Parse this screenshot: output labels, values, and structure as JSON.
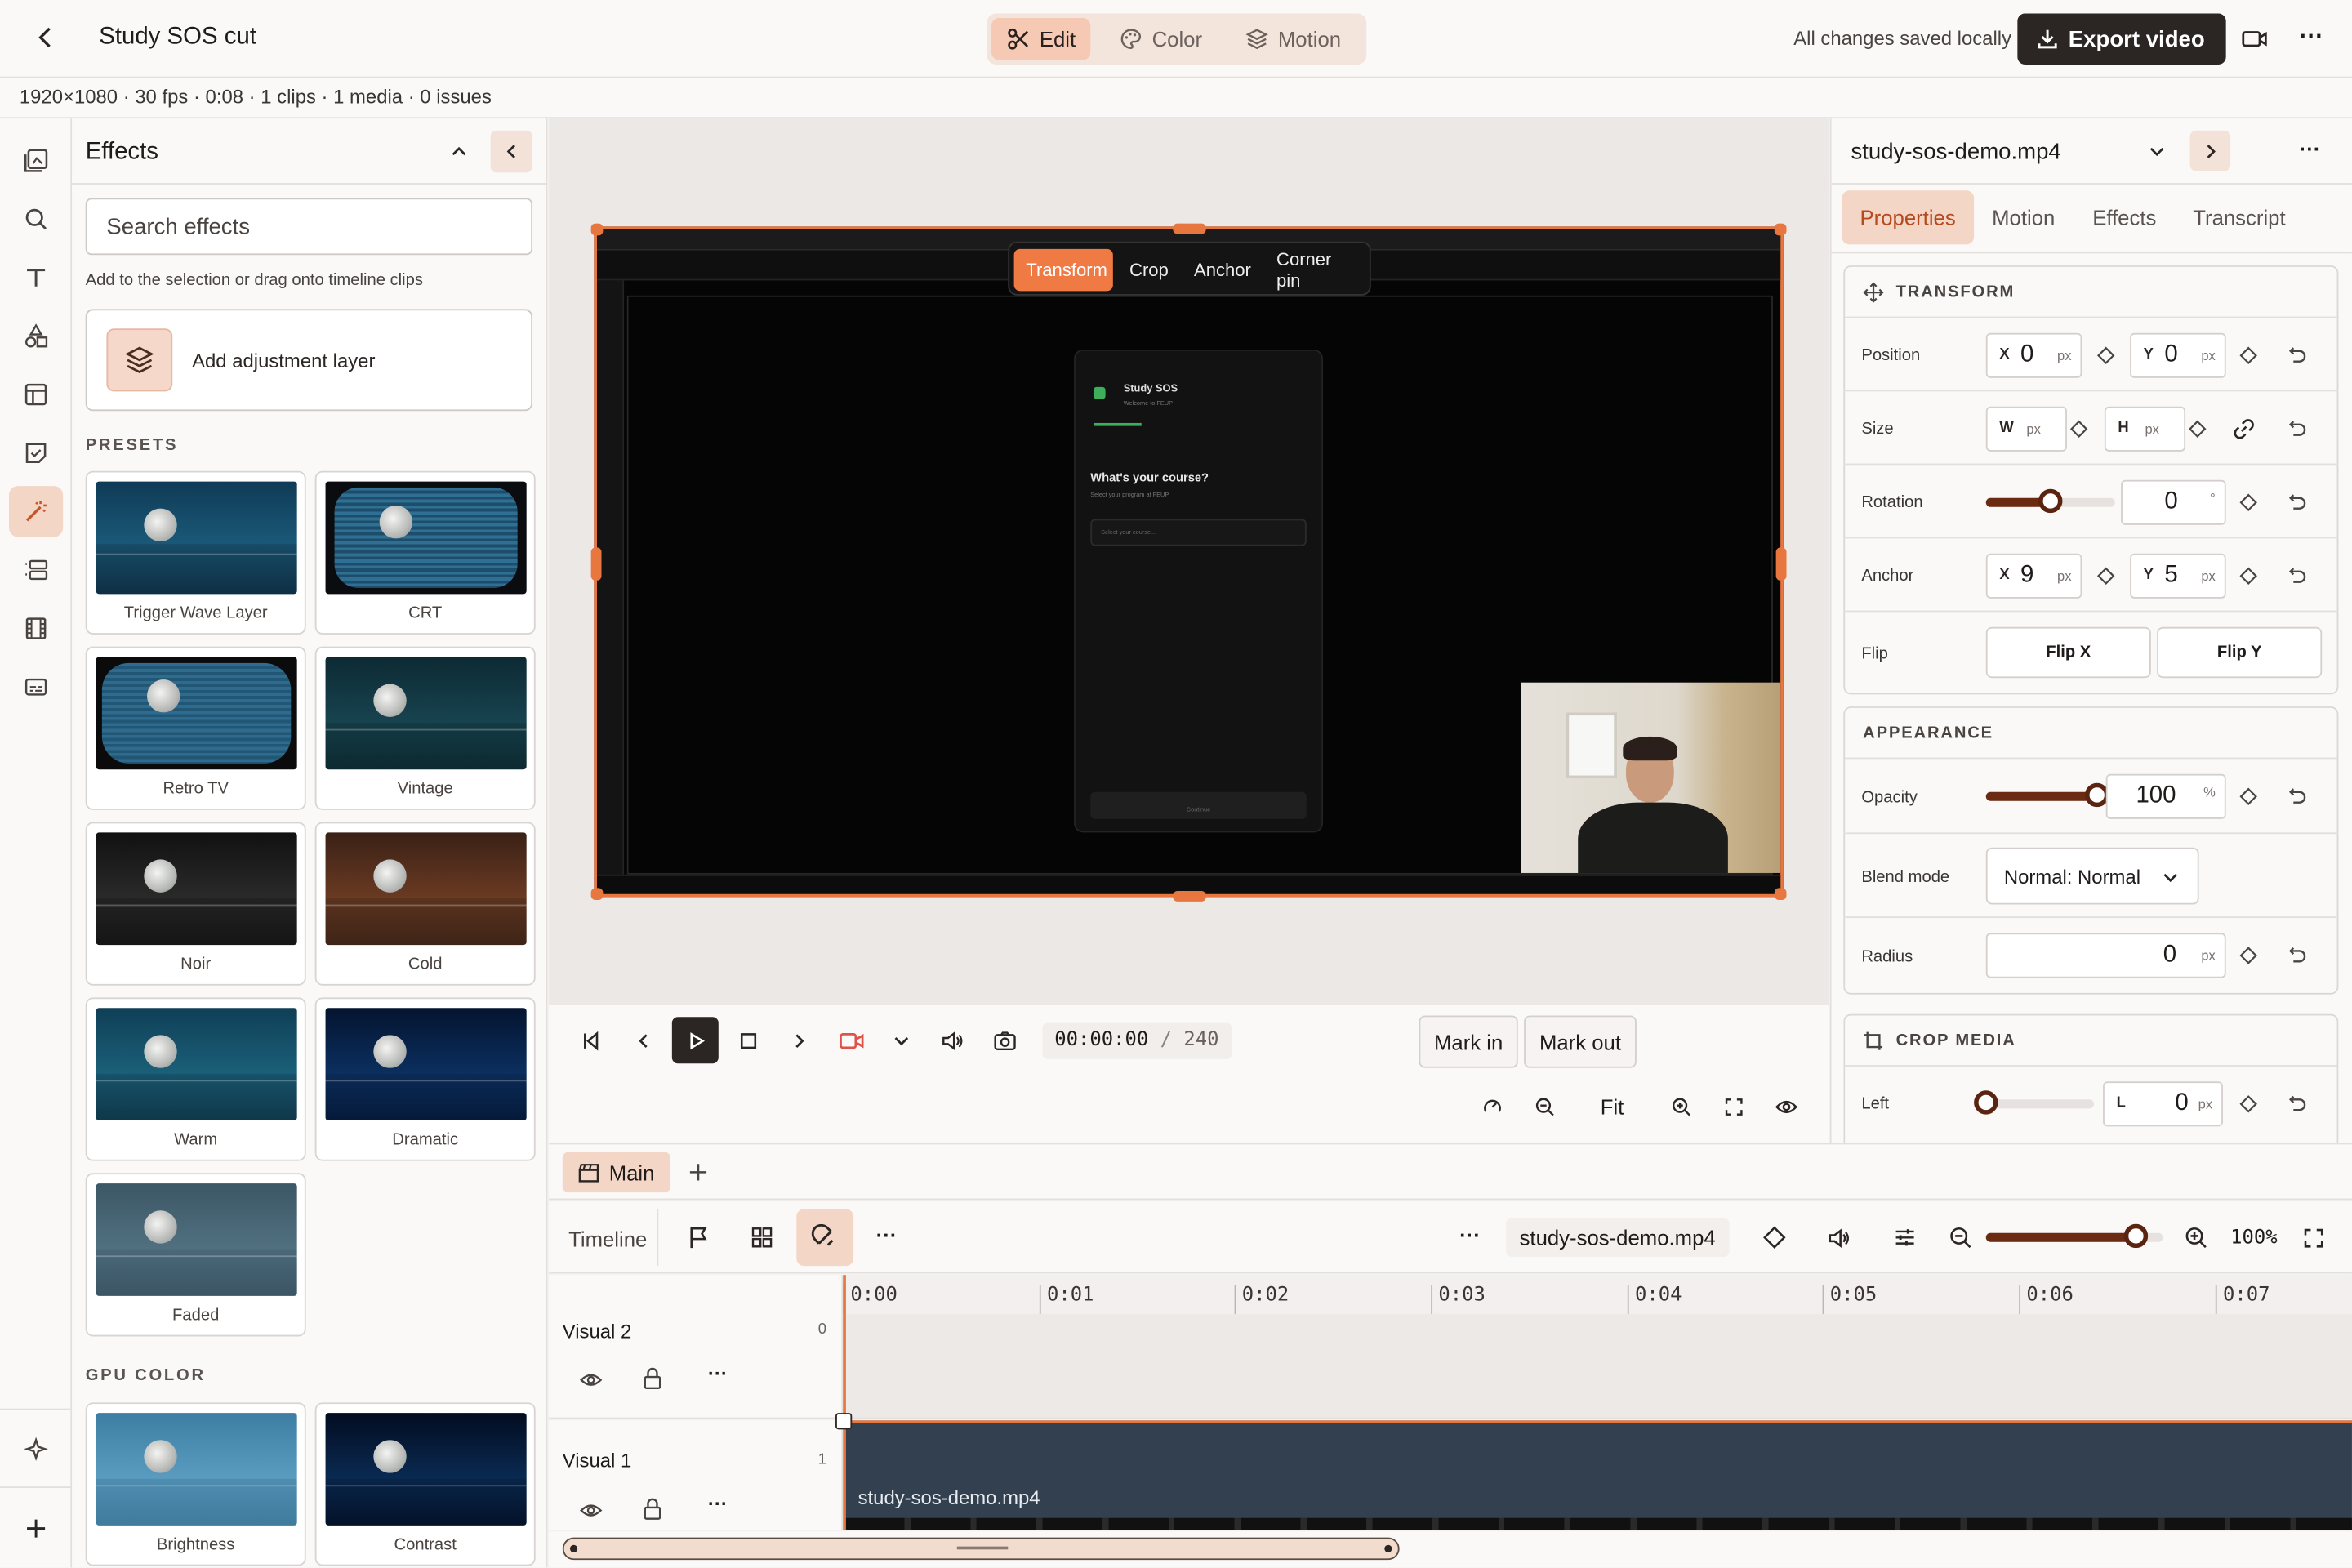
{
  "header": {
    "title": "Study SOS cut",
    "modes": [
      "Edit",
      "Color",
      "Motion"
    ],
    "save_status": "All changes saved locally",
    "export_label": "Export video"
  },
  "info": "1920×1080 · 30 fps · 0:08 · 1 clips · 1 media · 0 issues",
  "effects": {
    "title": "Effects",
    "search_placeholder": "Search effects",
    "hint": "Add to the selection or drag onto timeline clips",
    "adjustment_label": "Add adjustment layer",
    "presets_heading": "PRESETS",
    "presets": [
      "Trigger Wave Layer",
      "CRT",
      "Retro TV",
      "Vintage",
      "Noir",
      "Cold",
      "Warm",
      "Dramatic",
      "Faded"
    ],
    "gpu_heading": "GPU COLOR",
    "gpu": [
      "Brightness",
      "Contrast"
    ]
  },
  "canvas": {
    "tools": [
      "Transform",
      "Crop",
      "Anchor",
      "Corner pin"
    ],
    "app_title": "Study SOS",
    "app_subtitle": "Welcome to FEUP",
    "question": "What's your course?",
    "question_sub": "Select your program at FEUP",
    "select_placeholder": "Select your course...",
    "continue": "Continue"
  },
  "transport": {
    "timecode": "00:00:00",
    "total_frames": "240",
    "mark_in": "Mark in",
    "mark_out": "Mark out",
    "fit": "Fit"
  },
  "inspector": {
    "file": "study-sos-demo.mp4",
    "tabs": [
      "Properties",
      "Motion",
      "Effects",
      "Transcript"
    ],
    "transform_heading": "TRANSFORM",
    "position": {
      "label": "Position",
      "x": "0",
      "y": "0",
      "unit": "px"
    },
    "size": {
      "label": "Size",
      "w": "W",
      "h": "H",
      "unit": "px"
    },
    "rotation": {
      "label": "Rotation",
      "value": "0",
      "unit": "°",
      "level": 0.5
    },
    "anchor": {
      "label": "Anchor",
      "x": "9",
      "y": "5",
      "unit": "px"
    },
    "flip": {
      "label": "Flip",
      "x": "Flip X",
      "y": "Flip Y"
    },
    "appearance_heading": "APPEARANCE",
    "opacity": {
      "label": "Opacity",
      "value": "100",
      "unit": "%",
      "level": 1.0
    },
    "blend": {
      "label": "Blend mode",
      "value": "Normal: Normal"
    },
    "radius": {
      "label": "Radius",
      "value": "0",
      "unit": "px"
    },
    "crop_heading": "CROP MEDIA",
    "crop_left": {
      "label": "Left",
      "axis": "L",
      "value": "0",
      "unit": "px",
      "level": 0
    }
  },
  "timeline": {
    "sequence_tab": "Main",
    "label": "Timeline",
    "clip_name": "study-sos-demo.mp4",
    "zoom": "100%",
    "zoom_level": 0.85,
    "ticks": [
      "0:00",
      "0:01",
      "0:02",
      "0:03",
      "0:04",
      "0:05",
      "0:06",
      "0:07"
    ],
    "tracks": [
      {
        "name": "Visual 2",
        "index": "0"
      },
      {
        "name": "Visual 1",
        "index": "1"
      }
    ]
  }
}
